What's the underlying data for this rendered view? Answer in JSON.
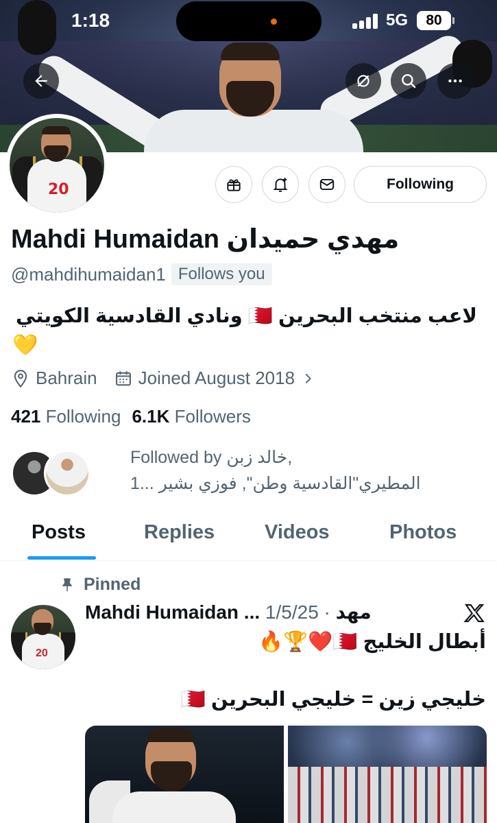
{
  "status_bar": {
    "time": "1:18",
    "network": "5G",
    "battery": "80"
  },
  "top_nav": {
    "back_icon": "arrow-left-icon",
    "hide_icon": "eye-slash-icon",
    "search_icon": "search-icon",
    "more_icon": "more-icon"
  },
  "profile": {
    "name": "Mahdi Humaidan مهدي حميدان",
    "handle": "@mahdihumaidan1",
    "follows_you": "Follows you",
    "bio": "لاعب منتخب البحرين 🇧🇭 ونادي القادسية الكويتي",
    "bio_emoji": "💛",
    "location": "Bahrain",
    "joined": "Joined August 2018",
    "following_count": "421",
    "following_label": "Following",
    "followers_count": "6.1K",
    "followers_label": "Followers",
    "followed_by_line1": "Followed by خالد زبن,",
    "followed_by_line2": "المطيري\"القادسية وطن\", فوزي بشير ...1"
  },
  "actions": {
    "follow_button": "Following"
  },
  "tabs": [
    {
      "label": "Posts",
      "active": true
    },
    {
      "label": "Replies",
      "active": false
    },
    {
      "label": "Videos",
      "active": false
    },
    {
      "label": "Photos",
      "active": false
    }
  ],
  "post": {
    "pinned_label": "Pinned",
    "author": "Mahdi Humaidan ... مهد",
    "date": "· 1/5/25",
    "line1": "أبطال الخليج 🇧🇭❤️🏆🔥",
    "line2": "خليجي زين = خليجي البحرين 🇧🇭"
  },
  "colors": {
    "accent": "#1d9bf0",
    "text": "#0f1419",
    "muted": "#536471",
    "border": "#cfd9de"
  }
}
